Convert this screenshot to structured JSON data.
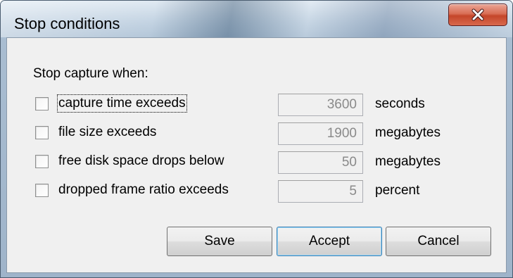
{
  "window": {
    "title": "Stop conditions",
    "close_symbol": "X"
  },
  "section_label": "Stop capture when:",
  "conditions": [
    {
      "label": "capture time exceeds",
      "value": "3600",
      "unit": "seconds",
      "checked": false
    },
    {
      "label": "file size exceeds",
      "value": "1900",
      "unit": "megabytes",
      "checked": false
    },
    {
      "label": "free disk space drops below",
      "value": "50",
      "unit": "megabytes",
      "checked": false
    },
    {
      "label": "dropped frame ratio exceeds",
      "value": "5",
      "unit": "percent",
      "checked": false
    }
  ],
  "buttons": {
    "save": "Save",
    "accept": "Accept",
    "cancel": "Cancel"
  },
  "colors": {
    "close_button": "#c4462a",
    "client_background": "#f0f0f0",
    "disabled_text": "#8a8a8a"
  },
  "icons": {
    "close": "close-icon"
  }
}
